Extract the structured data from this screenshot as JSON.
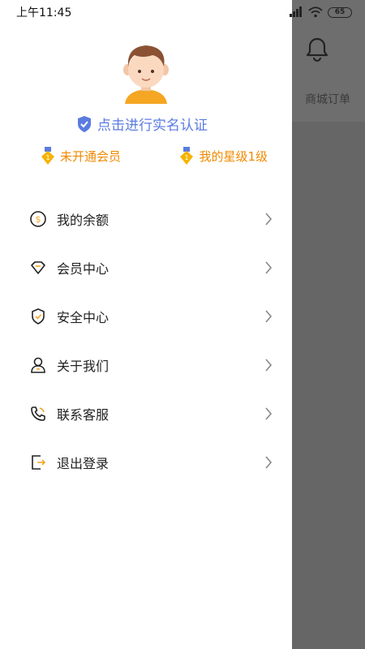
{
  "status_bar": {
    "time": "上午11:45",
    "battery": "65"
  },
  "background": {
    "orders_label": "商城订单"
  },
  "drawer": {
    "verify_text": "点击进行实名认证",
    "badges": [
      {
        "label": "未开通会员"
      },
      {
        "label": "我的星级1级"
      }
    ],
    "menu": [
      {
        "label": "我的余额",
        "icon": "coin-icon"
      },
      {
        "label": "会员中心",
        "icon": "diamond-icon"
      },
      {
        "label": "安全中心",
        "icon": "shield-icon"
      },
      {
        "label": "关于我们",
        "icon": "user-icon"
      },
      {
        "label": "联系客服",
        "icon": "phone-icon"
      },
      {
        "label": "退出登录",
        "icon": "logout-icon"
      }
    ]
  },
  "colors": {
    "accent_blue": "#5b7be0",
    "accent_orange": "#f08a00",
    "overlay": "#666666"
  }
}
